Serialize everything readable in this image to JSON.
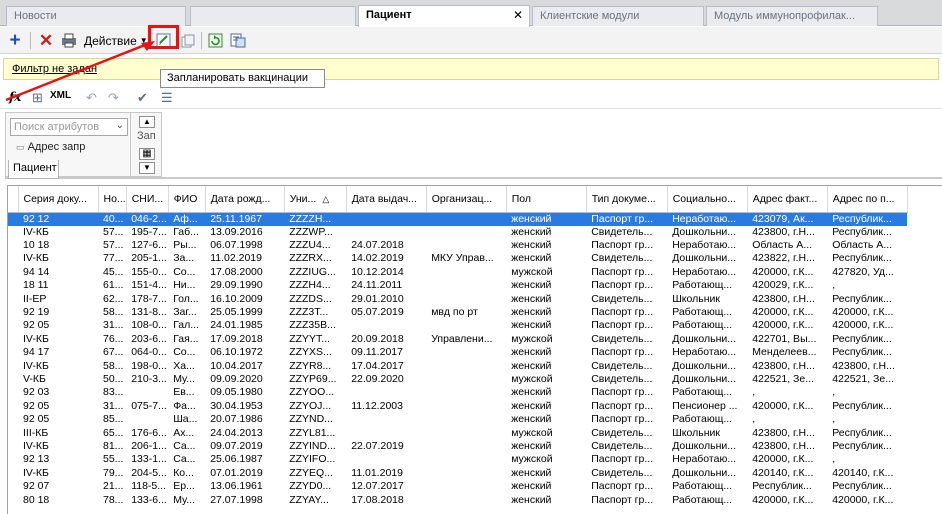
{
  "tabs": [
    {
      "label": "Новости",
      "active": false
    },
    {
      "label": "",
      "active": false
    },
    {
      "label": "Пациент",
      "active": true
    },
    {
      "label": "Клиентские модули",
      "active": false
    },
    {
      "label": "Модуль  иммунопрофилак...",
      "active": false
    }
  ],
  "toolbar": {
    "add_icon": "plus-icon",
    "delete_icon": "delete-x-icon",
    "action_label": "Действие",
    "plan_icon": "plan-vaccination-icon"
  },
  "filter": {
    "label": "Фильтр не задан"
  },
  "tooltip": {
    "text": "Запланировать вакцинации"
  },
  "formula_bar": {
    "fx": "fx",
    "xml": "XML"
  },
  "attributes": {
    "search_placeholder": "Поиск атрибутов",
    "item": "Адрес запр",
    "side_label": "Зап"
  },
  "panel_tab": "Пациент",
  "colors": {
    "highlight": "#e41414",
    "selection": "#2a7be0",
    "filter_bg": "#ffffd0"
  },
  "grid": {
    "columns": [
      "Серия доку...",
      "Но...",
      "СНИ...",
      "ФИО",
      "Дата рожд...",
      "Уни...",
      "Дата выдач...",
      "Организац...",
      "Пол",
      "Тип докуме...",
      "Социально...",
      "Адрес факт...",
      "Адрес по п..."
    ],
    "sorted_column_index": 5,
    "rows": [
      [
        "92 12",
        "40...",
        "046-2...",
        "Аф...",
        "25.11.1967",
        "ZZZZH...",
        "",
        "",
        "женский",
        "Паспорт гр...",
        "Неработаю...",
        "423079, Ак...",
        "Республик..."
      ],
      [
        "IV-КБ",
        "57...",
        "195-7...",
        "Габ...",
        "13.09.2016",
        "ZZZWP...",
        "",
        "",
        "женский",
        "Свидетель...",
        "Дошкольни...",
        "423800, г.Н...",
        "Республик..."
      ],
      [
        "10 18",
        "57...",
        "127-6...",
        "Ры...",
        "06.07.1998",
        "ZZZU4...",
        "24.07.2018",
        "",
        "женский",
        "Паспорт гр...",
        "Неработаю...",
        "Область А...",
        "Область А..."
      ],
      [
        "IV-КБ",
        "77...",
        "205-1...",
        "За...",
        "11.02.2019",
        "ZZZRX...",
        "14.02.2019",
        "МКУ Управ...",
        "женский",
        "Свидетель...",
        "Дошкольни...",
        "423822, г.Н...",
        "Республик..."
      ],
      [
        "94 14",
        "45...",
        "155-0...",
        "Со...",
        "17.08.2000",
        "ZZZIUG...",
        "10.12.2014",
        "",
        "мужской",
        "Паспорт гр...",
        "Неработаю...",
        "420000, г.К...",
        "427820, Уд..."
      ],
      [
        "18 11",
        "61...",
        "151-4...",
        "Ни...",
        "29.09.1990",
        "ZZZH4...",
        "24.11.2011",
        "",
        "женский",
        "Паспорт гр...",
        "Работающ...",
        "420029, г.К...",
        ","
      ],
      [
        "II-ЕР",
        "62...",
        "178-7...",
        "Гол...",
        "16.10.2009",
        "ZZZDS...",
        "29.01.2010",
        "",
        "женский",
        "Свидетель...",
        "Школьник",
        "423800, г.Н...",
        "Республик..."
      ],
      [
        "92 19",
        "58...",
        "131-8...",
        "Заг...",
        "25.05.1999",
        "ZZZ3T...",
        "05.07.2019",
        "мвд по рт",
        "женский",
        "Паспорт гр...",
        "Работающ...",
        "420000, г.К...",
        "420000, г.К..."
      ],
      [
        "92 05",
        "31...",
        "108-0...",
        "Гал...",
        "24.01.1985",
        "ZZZ35B...",
        "",
        "",
        "женский",
        "Паспорт гр...",
        "Работающ...",
        "420000, г.К...",
        "420000, г.К..."
      ],
      [
        "IV-КБ",
        "76...",
        "203-6...",
        "Гая...",
        "17.09.2018",
        "ZZYYT...",
        "20.09.2018",
        "Управлени...",
        "мужской",
        "Свидетель...",
        "Дошкольни...",
        "422701, Вы...",
        "Республик..."
      ],
      [
        "94 17",
        "67...",
        "064-0...",
        "Со...",
        "06.10.1972",
        "ZZYXS...",
        "09.11.2017",
        "",
        "женский",
        "Паспорт гр...",
        "Неработаю...",
        "Менделеев...",
        "Республик..."
      ],
      [
        "IV-КБ",
        "58...",
        "198-0...",
        "Ха...",
        "10.04.2017",
        "ZZYR8...",
        "17.04.2017",
        "",
        "женский",
        "Свидетель...",
        "Дошкольни...",
        "423800, г.Н...",
        "423800, г.Н..."
      ],
      [
        "V-КБ",
        "50...",
        "210-3...",
        "Му...",
        "09.09.2020",
        "ZZYP69...",
        "22.09.2020",
        "",
        "мужской",
        "Свидетель...",
        "Дошкольни...",
        "422521, Зе...",
        "422521, Зе..."
      ],
      [
        "92 03",
        "83...",
        "",
        "Ев...",
        "09.05.1980",
        "ZZYOO...",
        "",
        "",
        "женский",
        "Паспорт гр...",
        "Работающ...",
        ",",
        ","
      ],
      [
        "92 05",
        "31...",
        "075-7...",
        "Фа...",
        "30.04.1953",
        "ZZYOJ...",
        "11.12.2003",
        "",
        "женский",
        "Паспорт гр...",
        "Пенсионер ...",
        "420000, г.К...",
        "Республик..."
      ],
      [
        "92 05",
        "85...",
        "",
        "Ша...",
        "20.07.1986",
        "ZZYND...",
        "",
        "",
        "женский",
        "Паспорт гр...",
        "Работающ...",
        ",",
        ","
      ],
      [
        "III-КБ",
        "65...",
        "176-6...",
        "Ах...",
        "24.04.2013",
        "ZZYL81...",
        "",
        "",
        "мужской",
        "Свидетель...",
        "Школьник",
        "423800, г.Н...",
        "Республик..."
      ],
      [
        "IV-КБ",
        "81...",
        "206-1...",
        "Са...",
        "09.07.2019",
        "ZZYIND...",
        "22.07.2019",
        "",
        "женский",
        "Свидетель...",
        "Дошкольни...",
        "423800, г.Н...",
        "Республик..."
      ],
      [
        "92 13",
        "55...",
        "133-1...",
        "Са...",
        "25.06.1987",
        "ZZYIFO...",
        "",
        "",
        "мужской",
        "Паспорт гр...",
        "Неработаю...",
        "420000, г.К...",
        ","
      ],
      [
        "IV-КБ",
        "79...",
        "204-5...",
        "Ко...",
        "07.01.2019",
        "ZZYEQ...",
        "11.01.2019",
        "",
        "женский",
        "Свидетель...",
        "Дошкольни...",
        "420140, г.К...",
        "420140, г.К..."
      ],
      [
        "92 07",
        "21...",
        "118-5...",
        "Ер...",
        "13.06.1961",
        "ZZYD0...",
        "12.07.2017",
        "",
        "женский",
        "Паспорт гр...",
        "Работающ...",
        "Республик...",
        "Республик..."
      ],
      [
        "80 18",
        "78...",
        "133-6...",
        "Му...",
        "27.07.1998",
        "ZZYAY...",
        "17.08.2018",
        "",
        "женский",
        "Паспорт гр...",
        "Работающ...",
        "420000, г.К...",
        "420000, г.К..."
      ]
    ]
  }
}
